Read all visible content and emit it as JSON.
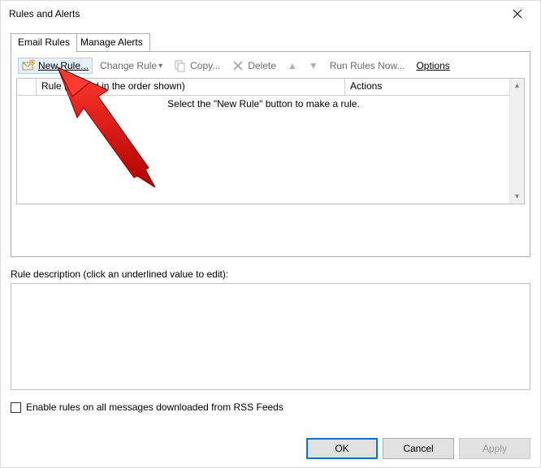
{
  "window": {
    "title": "Rules and Alerts"
  },
  "tabs": {
    "email_rules": "Email Rules",
    "manage_alerts": "Manage Alerts"
  },
  "toolbar": {
    "new_rule": "New Rule...",
    "change_rule": "Change Rule",
    "copy": "Copy...",
    "delete": "Delete",
    "run_rules_now": "Run Rules Now...",
    "options": "Options"
  },
  "columns": {
    "rule": "Rule (applied in the order shown)",
    "actions": "Actions"
  },
  "list": {
    "empty_message": "Select the \"New Rule\" button to make a rule."
  },
  "description": {
    "label": "Rule description (click an underlined value to edit):"
  },
  "rss": {
    "label": "Enable rules on all messages downloaded from RSS Feeds"
  },
  "buttons": {
    "ok": "OK",
    "cancel": "Cancel",
    "apply": "Apply"
  }
}
